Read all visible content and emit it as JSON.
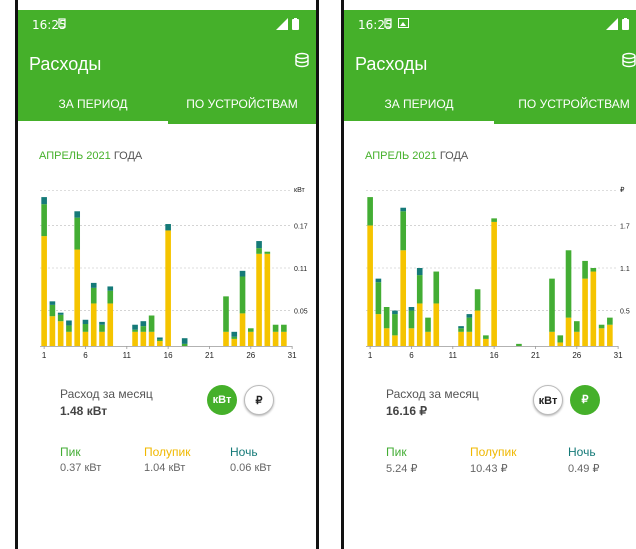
{
  "colors": {
    "green": "#45b02a",
    "peak": "#43ad34",
    "semipeak": "#f5c400",
    "night": "#157a78"
  },
  "left": {
    "status_time": "16:25",
    "title": "Расходы",
    "action_icon": "coins-icon",
    "tabs": [
      "ЗА ПЕРИОД",
      "ПО УСТРОЙСТВАМ"
    ],
    "period_month": "АПРЕЛЬ 2021",
    "period_year": "ГОДА",
    "summary_label": "Расход за месяц",
    "summary_value": "1.48 кВт",
    "unit_kwt": "кВт",
    "unit_rub": "₽",
    "tarifs": [
      {
        "label": "Пик",
        "value": "0.37 кВт"
      },
      {
        "label": "Полупик",
        "value": "1.04 кВт"
      },
      {
        "label": "Ночь",
        "value": "0.06 кВт"
      }
    ]
  },
  "right": {
    "status_time": "16:25",
    "title": "Расходы",
    "action_icon": "coins-icon",
    "tabs": [
      "ЗА ПЕРИОД",
      "ПО УСТРОЙСТВАМ"
    ],
    "period_month": "АПРЕЛЬ 2021",
    "period_year": "ГОДА",
    "summary_label": "Расход за месяц",
    "summary_value": "16.16 ₽",
    "unit_kwt": "кВт",
    "unit_rub": "₽",
    "tarifs": [
      {
        "label": "Пик",
        "value": "5.24 ₽"
      },
      {
        "label": "Полупик",
        "value": "10.43 ₽"
      },
      {
        "label": "Ночь",
        "value": "0.49 ₽"
      }
    ]
  },
  "chart_data": [
    {
      "type": "bar",
      "stacked": true,
      "title": "",
      "unit": "кВт",
      "x_ticks": [
        "1",
        "6",
        "11",
        "16",
        "21",
        "26",
        "31"
      ],
      "y_ticks": [
        {
          "value": 0.05,
          "label": "0.05"
        },
        {
          "value": 0.11,
          "label": "0.11"
        },
        {
          "value": 0.17,
          "label": "0.17"
        }
      ],
      "ylim": [
        0,
        0.22
      ],
      "categories": [
        1,
        2,
        3,
        4,
        5,
        6,
        7,
        8,
        9,
        10,
        11,
        12,
        13,
        14,
        15,
        16,
        17,
        18,
        19,
        20,
        21,
        22,
        23,
        24,
        25,
        26,
        27,
        28,
        29,
        30
      ],
      "series": [
        {
          "key": "semipeak",
          "values": [
            0.155,
            0.042,
            0.035,
            0.02,
            0.136,
            0.02,
            0.06,
            0.02,
            0.06,
            0,
            0,
            0.02,
            0.02,
            0.02,
            0.007,
            0.163,
            0,
            0,
            0,
            0,
            0,
            0,
            0.02,
            0.01,
            0.046,
            0.02,
            0.13,
            0.13,
            0.02,
            0.02
          ]
        },
        {
          "key": "peak",
          "values": [
            0.045,
            0.016,
            0.009,
            0.009,
            0.045,
            0.011,
            0.022,
            0.01,
            0.018,
            0,
            0,
            0.003,
            0.008,
            0.023,
            0.002,
            0,
            0,
            0.003,
            0,
            0,
            0,
            0,
            0.05,
            0.003,
            0.052,
            0.005,
            0.008,
            0.003,
            0.01,
            0.01
          ]
        },
        {
          "key": "night",
          "values": [
            0.01,
            0.005,
            0.003,
            0.007,
            0.009,
            0.006,
            0.007,
            0.004,
            0.006,
            0,
            0,
            0.007,
            0.007,
            0,
            0.003,
            0.009,
            0,
            0.008,
            0,
            0,
            0,
            0,
            0,
            0.007,
            0.008,
            0,
            0.01,
            0,
            0,
            0
          ]
        }
      ]
    },
    {
      "type": "bar",
      "stacked": true,
      "title": "",
      "unit": "₽",
      "x_ticks": [
        "1",
        "6",
        "11",
        "16",
        "21",
        "26",
        "31"
      ],
      "y_ticks": [
        {
          "value": 0.5,
          "label": "0.5"
        },
        {
          "value": 1.1,
          "label": "1.1"
        },
        {
          "value": 1.7,
          "label": "1.7"
        }
      ],
      "ylim": [
        0,
        2.2
      ],
      "categories": [
        1,
        2,
        3,
        4,
        5,
        6,
        7,
        8,
        9,
        10,
        11,
        12,
        13,
        14,
        15,
        16,
        17,
        18,
        19,
        20,
        21,
        22,
        23,
        24,
        25,
        26,
        27,
        28,
        29,
        30
      ],
      "series": [
        {
          "key": "semipeak",
          "values": [
            1.7,
            0.45,
            0.25,
            0.15,
            1.35,
            0.25,
            0.6,
            0.2,
            0.6,
            0,
            0,
            0.2,
            0.2,
            0.5,
            0.1,
            1.75,
            0,
            0,
            0,
            0,
            0,
            0,
            0.2,
            0.05,
            0.4,
            0.2,
            0.95,
            1.05,
            0.25,
            0.3
          ]
        },
        {
          "key": "peak",
          "values": [
            0.4,
            0.45,
            0.3,
            0.3,
            0.55,
            0.25,
            0.4,
            0.2,
            0.45,
            0,
            0,
            0.05,
            0.2,
            0.3,
            0.05,
            0.05,
            0,
            0,
            0.03,
            0,
            0,
            0,
            0.75,
            0.1,
            0.95,
            0.15,
            0.25,
            0.05,
            0.05,
            0.1
          ]
        },
        {
          "key": "night",
          "values": [
            0,
            0.05,
            0,
            0.05,
            0.05,
            0.05,
            0.1,
            0,
            0,
            0,
            0,
            0.03,
            0.05,
            0,
            0,
            0,
            0,
            0,
            0,
            0,
            0,
            0,
            0,
            0,
            0,
            0,
            0,
            0,
            0,
            0
          ]
        }
      ]
    }
  ]
}
